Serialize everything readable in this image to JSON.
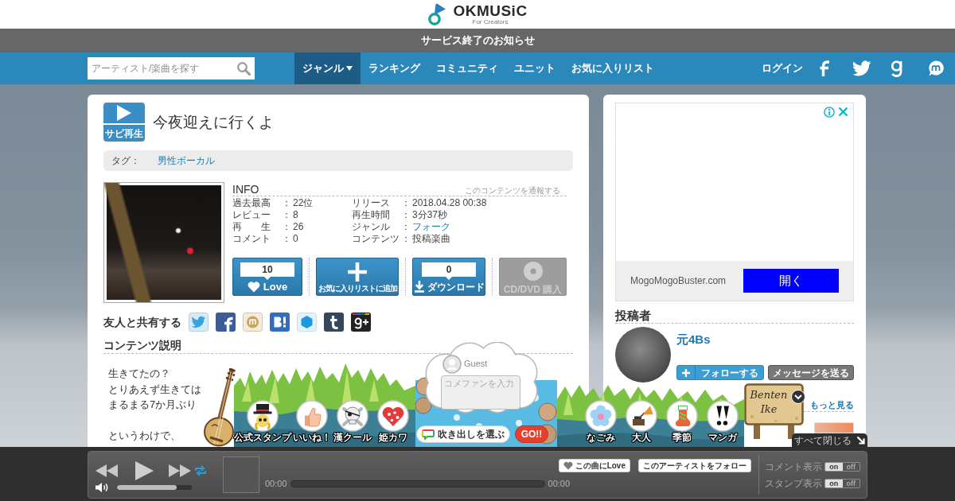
{
  "header": {
    "logo": {
      "wordmark": "OKMUSiC",
      "tagline": "For Creators"
    },
    "notice": "サービス終了のお知らせ"
  },
  "nav": {
    "search": {
      "placeholder": "アーティスト/楽曲を探す"
    },
    "items": [
      {
        "label": "ジャンル",
        "selected": true,
        "dropdown": true
      },
      {
        "label": "ランキング",
        "selected": false,
        "dropdown": false
      },
      {
        "label": "コミュニティ",
        "selected": false,
        "dropdown": false
      },
      {
        "label": "ユニット",
        "selected": false,
        "dropdown": false
      },
      {
        "label": "お気に入りリスト",
        "selected": false,
        "dropdown": false
      }
    ],
    "login": "ログイン"
  },
  "song": {
    "preview_label": "サビ再生",
    "title": "今夜迎えに行くよ",
    "tags": {
      "label": "タグ：",
      "items": [
        "男性ボーカル"
      ]
    },
    "info": {
      "heading": "INFO",
      "report_link": "このコンテンツを通報する",
      "columns": [
        [
          {
            "label": "過去最高",
            "separator": "：",
            "value": "22位",
            "link": false
          },
          {
            "label": "レビュー",
            "separator": "：",
            "value": "8",
            "link": false
          },
          {
            "label": "再　　生",
            "separator": "：",
            "value": "26",
            "link": false
          },
          {
            "label": "コメント",
            "separator": "：",
            "value": "0",
            "link": false
          }
        ],
        [
          {
            "label": "リリース",
            "separator": "：",
            "value": "2018.04.28 00:38",
            "link": false
          },
          {
            "label": "再生時間",
            "separator": "：",
            "value": "3分37秒",
            "link": false
          },
          {
            "label": "ジャンル",
            "separator": "：",
            "value": "フォーク",
            "link": true
          },
          {
            "label": "コンテンツ",
            "separator": "：",
            "value": "投稿楽曲",
            "link": false
          }
        ]
      ]
    },
    "actions": [
      {
        "kind": "love",
        "count": "10",
        "label": "Love",
        "disabled": false
      },
      {
        "kind": "favorite",
        "label": "お気に入りリストに追加",
        "disabled": false
      },
      {
        "kind": "download",
        "count": "0",
        "label": "ダウンロード",
        "disabled": false
      },
      {
        "kind": "purchase",
        "label": "CD/DVD 購入",
        "disabled": true
      }
    ],
    "share": {
      "label": "友人と共有する"
    },
    "description": {
      "heading": "コンテンツ説明",
      "paragraphs": [
        [
          "生きてたの？",
          "とりあえず生きては",
          "まるまる7か月ぶり"
        ],
        [
          "というわけで、"
        ]
      ]
    }
  },
  "sidebar": {
    "ad": {
      "domain": "MogoMogoBuster.com",
      "button": "開く"
    },
    "poster": {
      "heading": "投稿者",
      "name": "元4Bs",
      "follow_button": "フォローする",
      "message_button": "メッセージを送る",
      "more_link": "もっと見る"
    }
  },
  "stamp_bar": {
    "guest_name": "Guest",
    "comment": {
      "placeholder": "コメファンを入力"
    },
    "bubble_button": "吹き出しを選ぶ",
    "go_button": "GO!!",
    "stamp_groups": [
      [
        {
          "label": "公式スタンプ"
        },
        {
          "label": "いいね！"
        },
        {
          "label": "漢クール"
        },
        {
          "label": "姫カワ"
        }
      ],
      [
        {
          "label": "なごみ"
        },
        {
          "label": "大人"
        },
        {
          "label": "季節"
        },
        {
          "label": "マンガ"
        }
      ]
    ],
    "sign": "Benten Ike",
    "close_all": "すべて閉じる"
  },
  "player": {
    "repeat": true,
    "volume": {
      "level": 0.8
    },
    "elapsed": "00:00",
    "duration": "00:00",
    "love_button": "この曲にLove",
    "follow_button": "このアーティストをフォロー",
    "toggles": [
      {
        "label": "コメント表示",
        "on_text": "on",
        "off_text": "off",
        "on": true
      },
      {
        "label": "スタンプ表示",
        "on_text": "on",
        "off_text": "off",
        "on": true
      }
    ]
  }
}
